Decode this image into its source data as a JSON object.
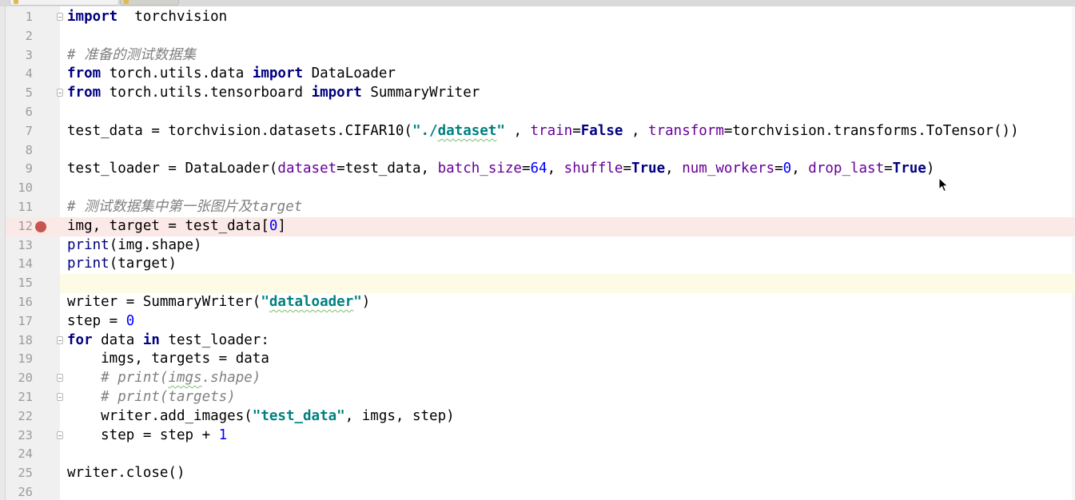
{
  "editor": {
    "tab_strip": {
      "tabs": [
        {
          "state": "active",
          "icon": "python-file-icon"
        },
        {
          "state": "inactive",
          "icon": "python-file-icon"
        }
      ]
    },
    "lines": [
      {
        "n": "1",
        "fold": true,
        "tokens": [
          [
            "kw",
            "import"
          ],
          [
            "",
            "  torchvision"
          ]
        ]
      },
      {
        "n": "2",
        "tokens": []
      },
      {
        "n": "3",
        "tokens": [
          [
            "cm",
            "# 准备的测试数据集"
          ]
        ]
      },
      {
        "n": "4",
        "tokens": [
          [
            "kw",
            "from"
          ],
          [
            "",
            " torch.utils.data "
          ],
          [
            "kw",
            "import"
          ],
          [
            "",
            " DataLoader"
          ]
        ]
      },
      {
        "n": "5",
        "fold": true,
        "tokens": [
          [
            "kw",
            "from"
          ],
          [
            "",
            " torch.utils.tensorboard "
          ],
          [
            "kw",
            "import"
          ],
          [
            "",
            " SummaryWriter"
          ]
        ]
      },
      {
        "n": "6",
        "tokens": []
      },
      {
        "n": "7",
        "tokens": [
          [
            "",
            "test_data = torchvision.datasets.CIFAR10("
          ],
          [
            "str",
            "\"./"
          ],
          [
            "str squig",
            "dataset"
          ],
          [
            "str",
            "\""
          ],
          [
            "",
            " , "
          ],
          [
            "kwa",
            "train"
          ],
          [
            "",
            "="
          ],
          [
            "kw",
            "False"
          ],
          [
            "",
            " , "
          ],
          [
            "kwa",
            "transform"
          ],
          [
            "",
            "=torchvision.transforms.ToTensor())"
          ]
        ]
      },
      {
        "n": "8",
        "tokens": []
      },
      {
        "n": "9",
        "tokens": [
          [
            "",
            "test_loader = DataLoader("
          ],
          [
            "kwa",
            "dataset"
          ],
          [
            "",
            "=test_data, "
          ],
          [
            "kwa",
            "batch_size"
          ],
          [
            "",
            "="
          ],
          [
            "num",
            "64"
          ],
          [
            "",
            ", "
          ],
          [
            "kwa",
            "shuffle"
          ],
          [
            "",
            "="
          ],
          [
            "kw",
            "True"
          ],
          [
            "",
            ", "
          ],
          [
            "kwa",
            "num_workers"
          ],
          [
            "",
            "="
          ],
          [
            "num",
            "0"
          ],
          [
            "",
            ", "
          ],
          [
            "kwa",
            "drop_last"
          ],
          [
            "",
            "="
          ],
          [
            "kw",
            "True"
          ],
          [
            "",
            ")"
          ]
        ]
      },
      {
        "n": "10",
        "tokens": []
      },
      {
        "n": "11",
        "tokens": [
          [
            "cm",
            "# 测试数据集中第一张图片及target"
          ]
        ]
      },
      {
        "n": "12",
        "breakpoint": true,
        "tokens": [
          [
            "",
            "img, target = test_data["
          ],
          [
            "num",
            "0"
          ],
          [
            "",
            "]"
          ]
        ]
      },
      {
        "n": "13",
        "tokens": [
          [
            "bi",
            "print"
          ],
          [
            "",
            "(img.shape)"
          ]
        ]
      },
      {
        "n": "14",
        "tokens": [
          [
            "bi",
            "print"
          ],
          [
            "",
            "(target)"
          ]
        ]
      },
      {
        "n": "15",
        "caret": true,
        "tokens": []
      },
      {
        "n": "16",
        "tokens": [
          [
            "",
            "writer = SummaryWriter("
          ],
          [
            "str",
            "\""
          ],
          [
            "str squig",
            "dataloader"
          ],
          [
            "str",
            "\""
          ],
          [
            "",
            ")"
          ]
        ]
      },
      {
        "n": "17",
        "tokens": [
          [
            "",
            "step = "
          ],
          [
            "num",
            "0"
          ]
        ]
      },
      {
        "n": "18",
        "fold": true,
        "tokens": [
          [
            "kw",
            "for"
          ],
          [
            "",
            " data "
          ],
          [
            "kw",
            "in"
          ],
          [
            "",
            " test_loader:"
          ]
        ]
      },
      {
        "n": "19",
        "tokens": [
          [
            "",
            "    imgs, targets = data"
          ]
        ]
      },
      {
        "n": "20",
        "fold": true,
        "tokens": [
          [
            "cm",
            "    # print("
          ],
          [
            "cm squig",
            "imgs"
          ],
          [
            "cm",
            ".shape)"
          ]
        ]
      },
      {
        "n": "21",
        "fold": true,
        "tokens": [
          [
            "cm",
            "    # print(targets)"
          ]
        ]
      },
      {
        "n": "22",
        "tokens": [
          [
            "",
            "    writer.add_images("
          ],
          [
            "str",
            "\"test_data\""
          ],
          [
            "",
            ", imgs, step)"
          ]
        ]
      },
      {
        "n": "23",
        "fold": true,
        "tokens": [
          [
            "",
            "    step = step + "
          ],
          [
            "num",
            "1"
          ]
        ]
      },
      {
        "n": "24",
        "tokens": []
      },
      {
        "n": "25",
        "tokens": [
          [
            "",
            "writer.close()"
          ]
        ]
      },
      {
        "n": "26",
        "tokens": []
      }
    ]
  },
  "colors": {
    "keyword": "#000080",
    "comment": "#808080",
    "string": "#008080",
    "number": "#0000ff",
    "keyword_arg": "#660099",
    "breakpoint": "#c75450",
    "breakpoint_line": "#fbe9e7",
    "caret_line": "#fdfbe6"
  }
}
